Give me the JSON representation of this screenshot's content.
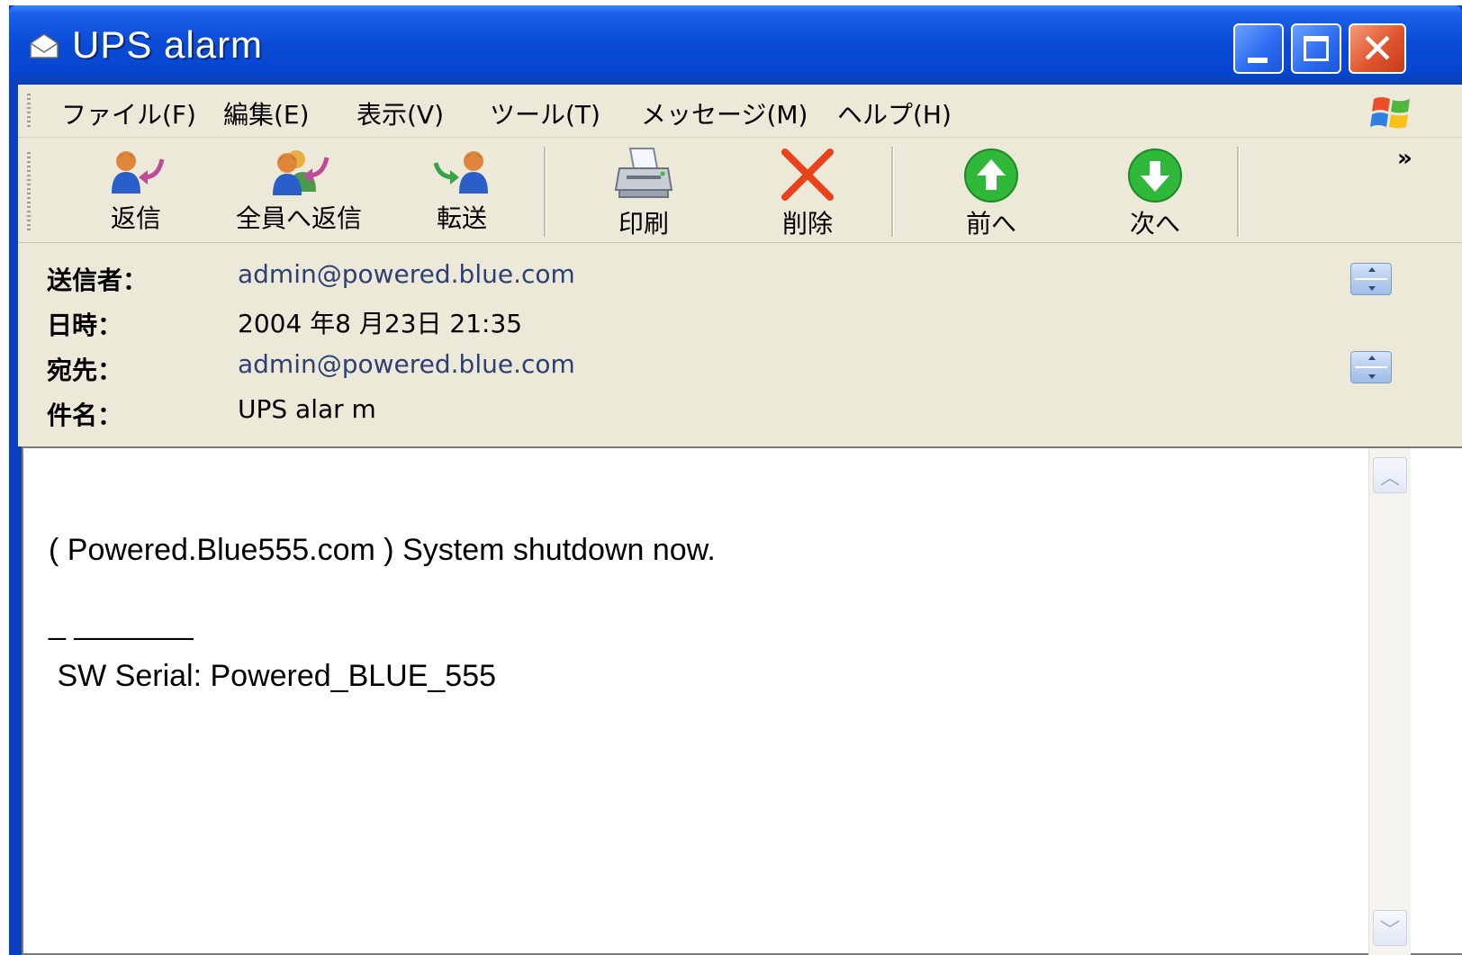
{
  "window": {
    "title": "UPS alarm"
  },
  "menu": {
    "items": [
      "ファイル(F)",
      "編集(E)",
      "表示(V)",
      "ツール(T)",
      "メッセージ(M)",
      "ヘルプ(H)"
    ]
  },
  "toolbar": {
    "buttons": [
      {
        "label": "返信",
        "icon": "reply-icon"
      },
      {
        "label": "全員へ返信",
        "icon": "reply-all-icon"
      },
      {
        "label": "転送",
        "icon": "forward-icon"
      },
      {
        "label": "印刷",
        "icon": "print-icon"
      },
      {
        "label": "削除",
        "icon": "delete-icon"
      },
      {
        "label": "前へ",
        "icon": "previous-icon"
      },
      {
        "label": "次へ",
        "icon": "next-icon"
      }
    ],
    "overflow": "»"
  },
  "header": {
    "from_label": "送信者：",
    "from_value": "admin@powered.blue.com",
    "date_label": "日時：",
    "date_value": "2004 年8 月23日 21:35",
    "to_label": "宛先：",
    "to_value": "admin@powered.blue.com",
    "subject_label": "件名：",
    "subject_value": "UPS alar m"
  },
  "message": {
    "lines": [
      "( Powered.Blue555.com ) System shutdown now.",
      "_ _______",
      " SW Serial: Powered_BLUE_555"
    ]
  },
  "colors": {
    "titlebar": "#0a4bd6",
    "chrome": "#ece9d8",
    "close": "#e0552e",
    "link": "#2d3f73"
  }
}
